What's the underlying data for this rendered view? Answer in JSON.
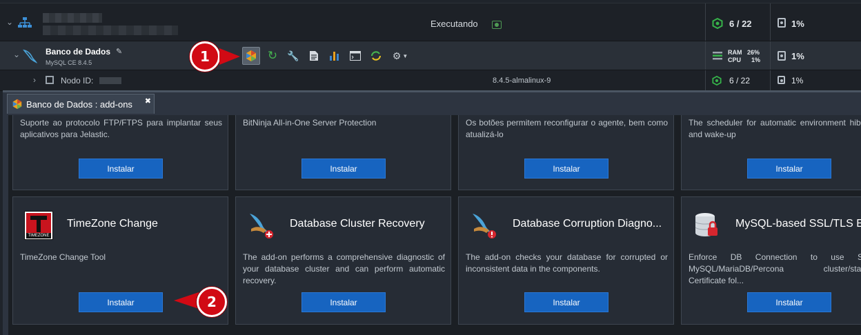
{
  "env": {
    "status": "Executando",
    "cloudlets": "6 / 22",
    "disk": "1%"
  },
  "database_row": {
    "name": "Banco de Dados",
    "version": "MySQL CE 8.4.5",
    "ram_label": "RAM",
    "ram_value": "26%",
    "cpu_label": "CPU",
    "cpu_value": "1%",
    "disk": "1%",
    "toolbar": [
      "add-ons-icon",
      "restart-icon",
      "config-wrench-icon",
      "log-file-icon",
      "statistics-icon",
      "web-ssh-icon",
      "redeploy-icon",
      "settings-gear-icon"
    ]
  },
  "node_row": {
    "label": "Nodo ID:",
    "version": "8.4.5-almalinux-9",
    "cloudlets": "6 / 22",
    "disk": "1%"
  },
  "callouts": {
    "first": "1",
    "second": "2"
  },
  "panel": {
    "tab_label": "Banco de Dados : add-ons",
    "install_label": "Instalar",
    "top_cards": [
      {
        "desc": "Suporte ao protocolo FTP/FTPS para implantar seus aplicativos para Jelastic."
      },
      {
        "desc": "BitNinja All-in-One Server Protection"
      },
      {
        "desc": "Os botões permitem reconfigurar o agente, bem como atualizá-lo"
      },
      {
        "desc": "The scheduler for automatic environment hibernation and wake-up"
      }
    ],
    "bottom_cards": [
      {
        "title": "TimeZone Change",
        "logo_text": "TIMEZONE",
        "desc": "TimeZone Change Tool"
      },
      {
        "title": "Database Cluster Recovery",
        "desc": "The add-on performs a comprehensive diagnostic of your database cluster and can perform automatic recovery."
      },
      {
        "title": "Database Corruption Diagno...",
        "desc": "The add-on checks your database for corrupted or inconsistent data in the components."
      },
      {
        "title": "MySQL-based SSL/TLS Enc",
        "desc": "Enforce DB Connection to use SSL/TLS MySQL/MariaDB/Percona cluster/standalone Certificate fol..."
      }
    ]
  },
  "colors": {
    "accent": "#1764c0",
    "callout": "#d10a14",
    "ok": "#4f9a54"
  }
}
